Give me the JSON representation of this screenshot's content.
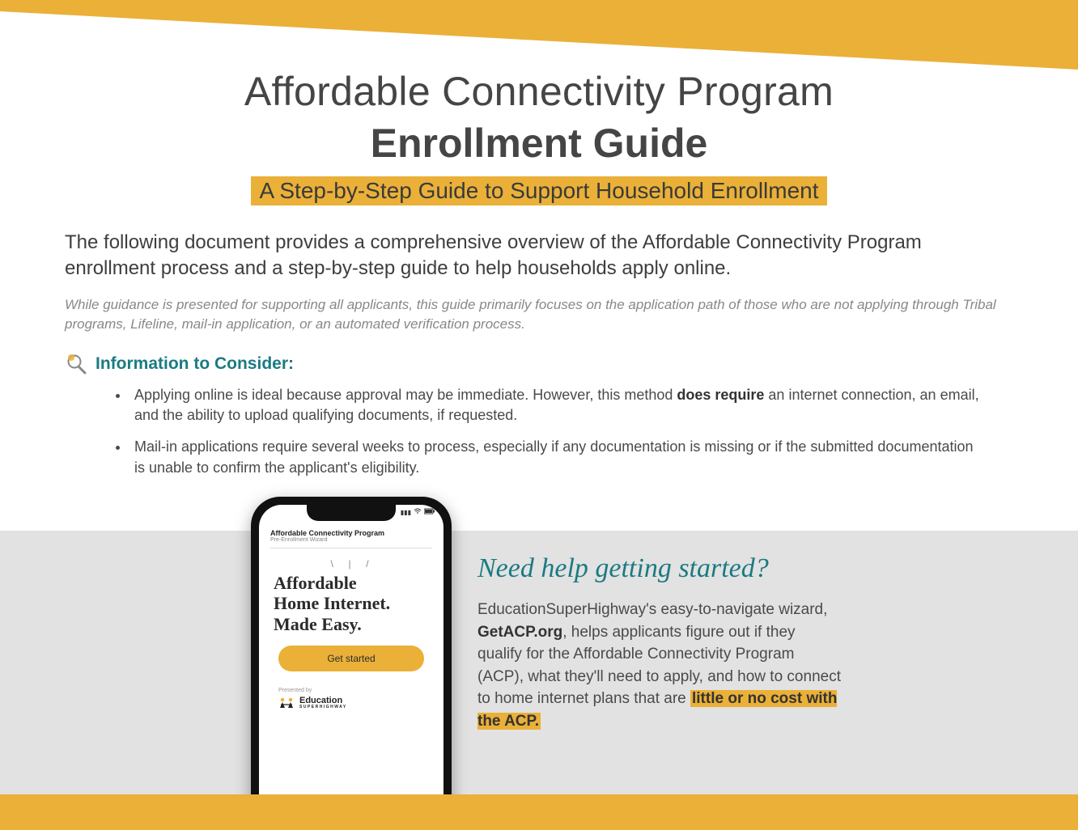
{
  "header": {
    "title_line1": "Affordable Connectivity Program",
    "title_line2": "Enrollment Guide",
    "subtitle": "A Step-by-Step Guide to Support Household Enrollment"
  },
  "intro": "The following document provides a comprehensive overview of the Affordable Connectivity Program enrollment process and a step-by-step guide to help households apply online.",
  "note": "While guidance is presented for supporting all applicants, this guide primarily focuses on the application path of those who are not applying through Tribal programs, Lifeline, mail-in application, or an automated verification process.",
  "consider": {
    "heading": "Information to Consider:",
    "bullets": [
      {
        "pre": "Applying online is ideal because approval may be immediate. However, this method ",
        "bold": "does require",
        "post": " an internet connection, an email, and the ability to upload qualifying documents, if requested."
      },
      {
        "pre": "Mail-in applications require several weeks to process, especially if any documentation is missing or if the submitted documentation is unable to confirm the applicant's eligibility.",
        "bold": "",
        "post": ""
      }
    ]
  },
  "phone": {
    "app_title": "Affordable Connectivity Program",
    "app_subtitle": "Pre-Enrollment Wizard",
    "headline_l1": "Affordable",
    "headline_l2": "Home Internet.",
    "headline_l3": "Made Easy.",
    "button": "Get started",
    "presented_by": "Presented by",
    "org_name": "Education",
    "org_sub": "SUPERHIGHWAY"
  },
  "help": {
    "heading": "Need help getting started?",
    "body_pre": "EducationSuperHighway's easy-to-navigate wizard, ",
    "site": "GetACP.org",
    "body_mid": ", helps applicants figure out if they qualify for the Affordable Connectivity Program (ACP), what they'll need to apply, and how to connect to home internet plans that are ",
    "highlight": "little or no cost with the ACP."
  },
  "colors": {
    "accent": "#eab038",
    "teal": "#1b7a82",
    "gray_panel": "#e2e2e2"
  }
}
